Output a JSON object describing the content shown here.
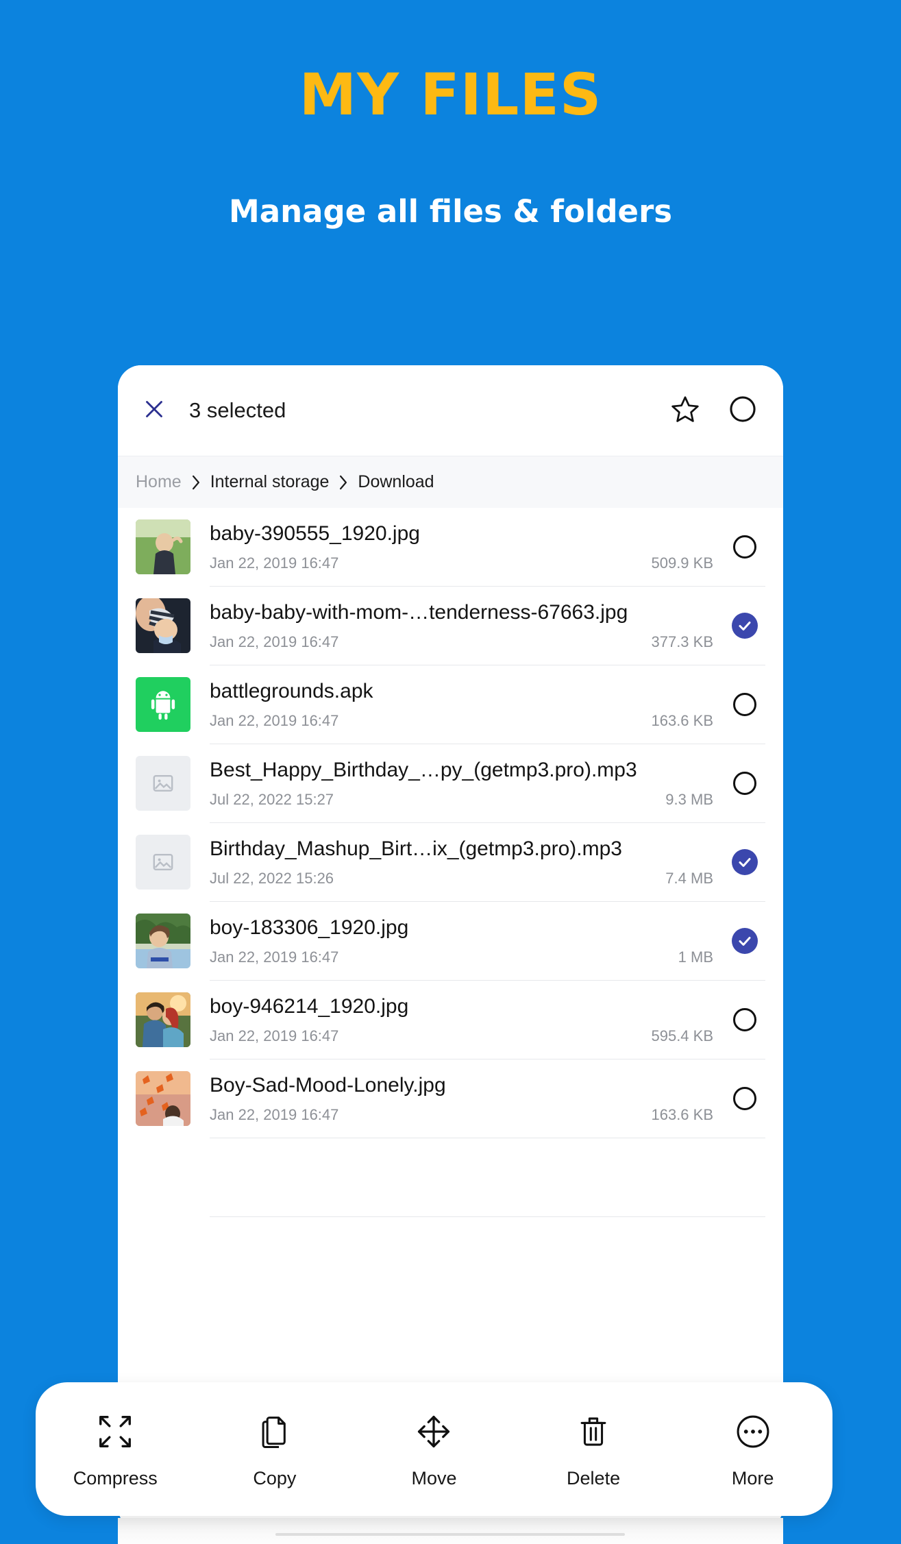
{
  "promo": {
    "title": "MY FILES",
    "subtitle": "Manage all files & folders",
    "background_color": "#0c83de",
    "title_color": "#fdb913",
    "subtitle_color": "#ffffff"
  },
  "appbar": {
    "close_icon": "close-icon",
    "selected_label": "3 selected",
    "star_icon": "star-icon",
    "select_all_icon": "select-all-circle-icon"
  },
  "breadcrumb": {
    "separator": "›",
    "items": [
      {
        "label": "Home",
        "muted": true
      },
      {
        "label": "Internal storage",
        "muted": false
      },
      {
        "label": "Download",
        "muted": false
      }
    ]
  },
  "files": [
    {
      "name": "baby-390555_1920.jpg",
      "date": "Jan 22, 2019 16:47",
      "size": "509.9 KB",
      "selected": false,
      "thumb": "photo-baby-grass"
    },
    {
      "name": "baby-baby-with-mom-…tenderness-67663.jpg",
      "date": "Jan 22, 2019 16:47",
      "size": "377.3 KB",
      "selected": true,
      "thumb": "photo-baby-hat"
    },
    {
      "name": "battlegrounds.apk",
      "date": "Jan 22, 2019 16:47",
      "size": "163.6 KB",
      "selected": false,
      "thumb": "android-apk-icon"
    },
    {
      "name": "Best_Happy_Birthday_…py_(getmp3.pro).mp3",
      "date": "Jul 22, 2022 15:27",
      "size": "9.3 MB",
      "selected": false,
      "thumb": "image-placeholder-icon"
    },
    {
      "name": "Birthday_Mashup_Birt…ix_(getmp3.pro).mp3",
      "date": "Jul 22, 2022 15:26",
      "size": "7.4 MB",
      "selected": true,
      "thumb": "image-placeholder-icon"
    },
    {
      "name": "boy-183306_1920.jpg",
      "date": "Jan 22, 2019 16:47",
      "size": "1 MB",
      "selected": true,
      "thumb": "photo-boy-trees"
    },
    {
      "name": "boy-946214_1920.jpg",
      "date": "Jan 22, 2019 16:47",
      "size": "595.4 KB",
      "selected": false,
      "thumb": "photo-couple-sunset"
    },
    {
      "name": "Boy-Sad-Mood-Lonely.jpg",
      "date": "Jan 22, 2019 16:47",
      "size": "163.6 KB",
      "selected": false,
      "thumb": "photo-autumn-leaves"
    }
  ],
  "actionbar": {
    "items": [
      {
        "label": "Compress",
        "icon": "compress-icon"
      },
      {
        "label": "Copy",
        "icon": "copy-icon"
      },
      {
        "label": "Move",
        "icon": "move-icon"
      },
      {
        "label": "Delete",
        "icon": "trash-icon"
      },
      {
        "label": "More",
        "icon": "more-dots-icon"
      }
    ]
  },
  "colors": {
    "accent_blue": "#0c83de",
    "brand_yellow": "#fdb913",
    "selected_checkbox": "#3b47ad",
    "apk_green": "#20cf5f",
    "close_icon": "#2b2f8f"
  }
}
